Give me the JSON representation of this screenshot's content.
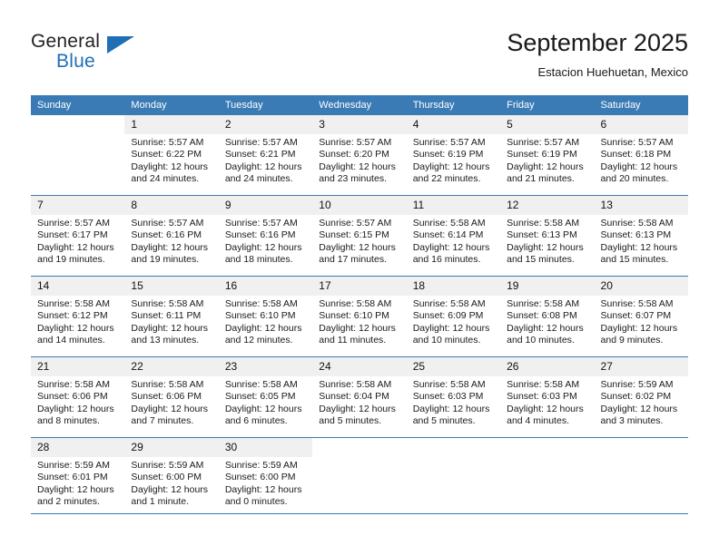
{
  "brand": {
    "name_top": "General",
    "name_bottom": "Blue",
    "accent_color": "#1f6fb5",
    "triangle_icon": "triangle-icon"
  },
  "header": {
    "month_title": "September 2025",
    "location": "Estacion Huehuetan, Mexico"
  },
  "calendar": {
    "header_color": "#3b7bb5",
    "daynum_bg": "#f0f0f0",
    "weekdays": [
      "Sunday",
      "Monday",
      "Tuesday",
      "Wednesday",
      "Thursday",
      "Friday",
      "Saturday"
    ],
    "weeks": [
      [
        {
          "day": "",
          "sunrise": "",
          "sunset": "",
          "daylight1": "",
          "daylight2": ""
        },
        {
          "day": "1",
          "sunrise": "Sunrise: 5:57 AM",
          "sunset": "Sunset: 6:22 PM",
          "daylight1": "Daylight: 12 hours",
          "daylight2": "and 24 minutes."
        },
        {
          "day": "2",
          "sunrise": "Sunrise: 5:57 AM",
          "sunset": "Sunset: 6:21 PM",
          "daylight1": "Daylight: 12 hours",
          "daylight2": "and 24 minutes."
        },
        {
          "day": "3",
          "sunrise": "Sunrise: 5:57 AM",
          "sunset": "Sunset: 6:20 PM",
          "daylight1": "Daylight: 12 hours",
          "daylight2": "and 23 minutes."
        },
        {
          "day": "4",
          "sunrise": "Sunrise: 5:57 AM",
          "sunset": "Sunset: 6:19 PM",
          "daylight1": "Daylight: 12 hours",
          "daylight2": "and 22 minutes."
        },
        {
          "day": "5",
          "sunrise": "Sunrise: 5:57 AM",
          "sunset": "Sunset: 6:19 PM",
          "daylight1": "Daylight: 12 hours",
          "daylight2": "and 21 minutes."
        },
        {
          "day": "6",
          "sunrise": "Sunrise: 5:57 AM",
          "sunset": "Sunset: 6:18 PM",
          "daylight1": "Daylight: 12 hours",
          "daylight2": "and 20 minutes."
        }
      ],
      [
        {
          "day": "7",
          "sunrise": "Sunrise: 5:57 AM",
          "sunset": "Sunset: 6:17 PM",
          "daylight1": "Daylight: 12 hours",
          "daylight2": "and 19 minutes."
        },
        {
          "day": "8",
          "sunrise": "Sunrise: 5:57 AM",
          "sunset": "Sunset: 6:16 PM",
          "daylight1": "Daylight: 12 hours",
          "daylight2": "and 19 minutes."
        },
        {
          "day": "9",
          "sunrise": "Sunrise: 5:57 AM",
          "sunset": "Sunset: 6:16 PM",
          "daylight1": "Daylight: 12 hours",
          "daylight2": "and 18 minutes."
        },
        {
          "day": "10",
          "sunrise": "Sunrise: 5:57 AM",
          "sunset": "Sunset: 6:15 PM",
          "daylight1": "Daylight: 12 hours",
          "daylight2": "and 17 minutes."
        },
        {
          "day": "11",
          "sunrise": "Sunrise: 5:58 AM",
          "sunset": "Sunset: 6:14 PM",
          "daylight1": "Daylight: 12 hours",
          "daylight2": "and 16 minutes."
        },
        {
          "day": "12",
          "sunrise": "Sunrise: 5:58 AM",
          "sunset": "Sunset: 6:13 PM",
          "daylight1": "Daylight: 12 hours",
          "daylight2": "and 15 minutes."
        },
        {
          "day": "13",
          "sunrise": "Sunrise: 5:58 AM",
          "sunset": "Sunset: 6:13 PM",
          "daylight1": "Daylight: 12 hours",
          "daylight2": "and 15 minutes."
        }
      ],
      [
        {
          "day": "14",
          "sunrise": "Sunrise: 5:58 AM",
          "sunset": "Sunset: 6:12 PM",
          "daylight1": "Daylight: 12 hours",
          "daylight2": "and 14 minutes."
        },
        {
          "day": "15",
          "sunrise": "Sunrise: 5:58 AM",
          "sunset": "Sunset: 6:11 PM",
          "daylight1": "Daylight: 12 hours",
          "daylight2": "and 13 minutes."
        },
        {
          "day": "16",
          "sunrise": "Sunrise: 5:58 AM",
          "sunset": "Sunset: 6:10 PM",
          "daylight1": "Daylight: 12 hours",
          "daylight2": "and 12 minutes."
        },
        {
          "day": "17",
          "sunrise": "Sunrise: 5:58 AM",
          "sunset": "Sunset: 6:10 PM",
          "daylight1": "Daylight: 12 hours",
          "daylight2": "and 11 minutes."
        },
        {
          "day": "18",
          "sunrise": "Sunrise: 5:58 AM",
          "sunset": "Sunset: 6:09 PM",
          "daylight1": "Daylight: 12 hours",
          "daylight2": "and 10 minutes."
        },
        {
          "day": "19",
          "sunrise": "Sunrise: 5:58 AM",
          "sunset": "Sunset: 6:08 PM",
          "daylight1": "Daylight: 12 hours",
          "daylight2": "and 10 minutes."
        },
        {
          "day": "20",
          "sunrise": "Sunrise: 5:58 AM",
          "sunset": "Sunset: 6:07 PM",
          "daylight1": "Daylight: 12 hours",
          "daylight2": "and 9 minutes."
        }
      ],
      [
        {
          "day": "21",
          "sunrise": "Sunrise: 5:58 AM",
          "sunset": "Sunset: 6:06 PM",
          "daylight1": "Daylight: 12 hours",
          "daylight2": "and 8 minutes."
        },
        {
          "day": "22",
          "sunrise": "Sunrise: 5:58 AM",
          "sunset": "Sunset: 6:06 PM",
          "daylight1": "Daylight: 12 hours",
          "daylight2": "and 7 minutes."
        },
        {
          "day": "23",
          "sunrise": "Sunrise: 5:58 AM",
          "sunset": "Sunset: 6:05 PM",
          "daylight1": "Daylight: 12 hours",
          "daylight2": "and 6 minutes."
        },
        {
          "day": "24",
          "sunrise": "Sunrise: 5:58 AM",
          "sunset": "Sunset: 6:04 PM",
          "daylight1": "Daylight: 12 hours",
          "daylight2": "and 5 minutes."
        },
        {
          "day": "25",
          "sunrise": "Sunrise: 5:58 AM",
          "sunset": "Sunset: 6:03 PM",
          "daylight1": "Daylight: 12 hours",
          "daylight2": "and 5 minutes."
        },
        {
          "day": "26",
          "sunrise": "Sunrise: 5:58 AM",
          "sunset": "Sunset: 6:03 PM",
          "daylight1": "Daylight: 12 hours",
          "daylight2": "and 4 minutes."
        },
        {
          "day": "27",
          "sunrise": "Sunrise: 5:59 AM",
          "sunset": "Sunset: 6:02 PM",
          "daylight1": "Daylight: 12 hours",
          "daylight2": "and 3 minutes."
        }
      ],
      [
        {
          "day": "28",
          "sunrise": "Sunrise: 5:59 AM",
          "sunset": "Sunset: 6:01 PM",
          "daylight1": "Daylight: 12 hours",
          "daylight2": "and 2 minutes."
        },
        {
          "day": "29",
          "sunrise": "Sunrise: 5:59 AM",
          "sunset": "Sunset: 6:00 PM",
          "daylight1": "Daylight: 12 hours",
          "daylight2": "and 1 minute."
        },
        {
          "day": "30",
          "sunrise": "Sunrise: 5:59 AM",
          "sunset": "Sunset: 6:00 PM",
          "daylight1": "Daylight: 12 hours",
          "daylight2": "and 0 minutes."
        },
        {
          "day": "",
          "sunrise": "",
          "sunset": "",
          "daylight1": "",
          "daylight2": ""
        },
        {
          "day": "",
          "sunrise": "",
          "sunset": "",
          "daylight1": "",
          "daylight2": ""
        },
        {
          "day": "",
          "sunrise": "",
          "sunset": "",
          "daylight1": "",
          "daylight2": ""
        },
        {
          "day": "",
          "sunrise": "",
          "sunset": "",
          "daylight1": "",
          "daylight2": ""
        }
      ]
    ]
  }
}
